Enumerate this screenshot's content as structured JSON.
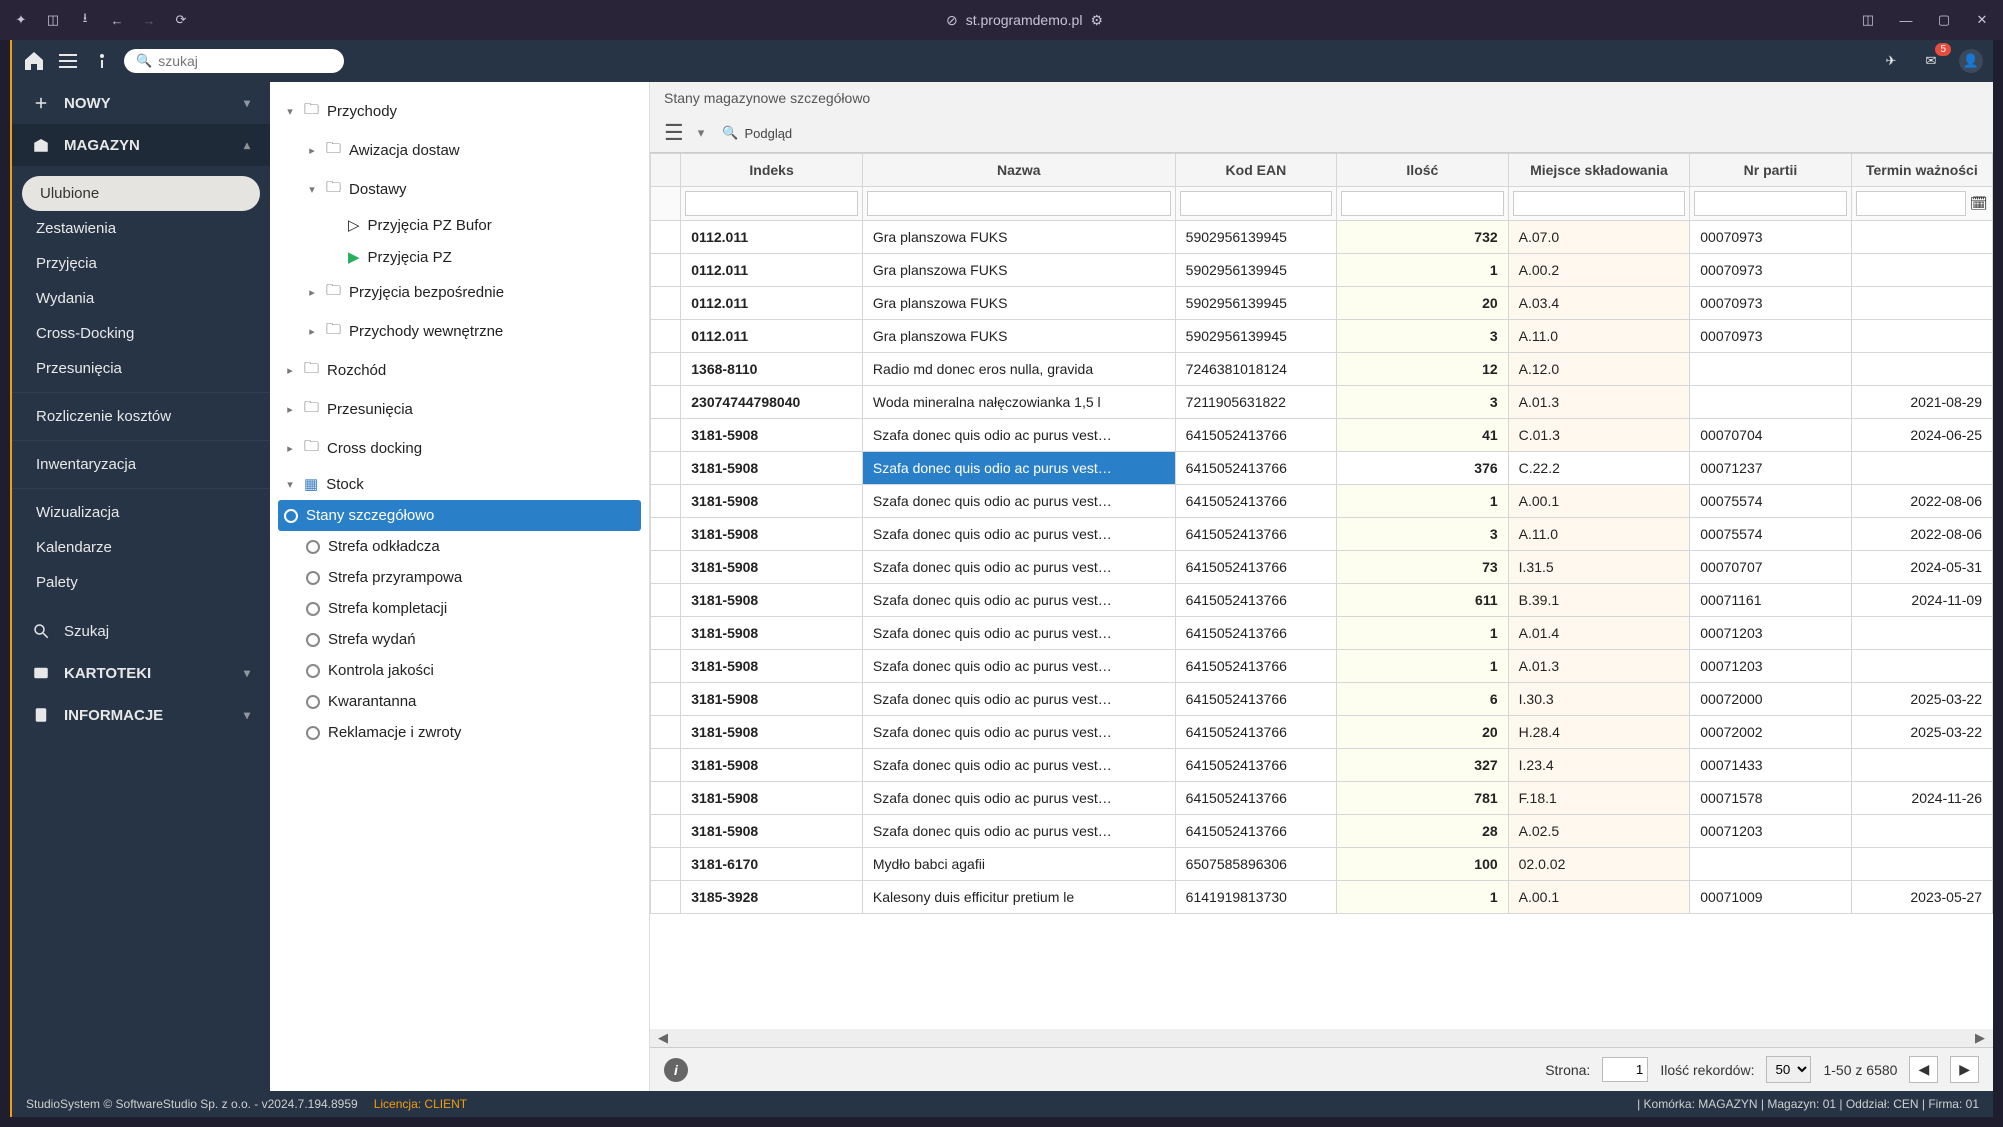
{
  "browser": {
    "url": "st.programdemo.pl"
  },
  "search_placeholder": "szukaj",
  "leftnav": {
    "new": "NOWY",
    "warehouse": "MAGAZYN",
    "items": [
      "Ulubione",
      "Zestawienia",
      "Przyjęcia",
      "Wydania",
      "Cross-Docking",
      "Przesunięcia"
    ],
    "items2": [
      "Rozliczenie kosztów"
    ],
    "items3": [
      "Inwentaryzacja"
    ],
    "items4": [
      "Wizualizacja",
      "Kalendarze",
      "Palety"
    ],
    "search": "Szukaj",
    "kartoteki": "KARTOTEKI",
    "informacje": "INFORMACJE"
  },
  "tree": {
    "przychody": "Przychody",
    "awizacja": "Awizacja dostaw",
    "dostawy": "Dostawy",
    "pz_bufor": "Przyjęcia PZ Bufor",
    "pz": "Przyjęcia PZ",
    "bezposrednie": "Przyjęcia bezpośrednie",
    "wewnetrzne": "Przychody wewnętrzne",
    "rozchod": "Rozchód",
    "przesuniecia": "Przesunięcia",
    "crossdocking": "Cross docking",
    "stock": "Stock",
    "stany": "Stany szczegółowo",
    "strefa_odk": "Strefa odkładcza",
    "strefa_przy": "Strefa przyrampowa",
    "strefa_komp": "Strefa kompletacji",
    "strefa_wyd": "Strefa wydań",
    "kontrola": "Kontrola jakości",
    "kwarantanna": "Kwarantanna",
    "reklamacje": "Reklamacje i zwroty"
  },
  "content": {
    "title": "Stany magazynowe szczegółowo",
    "preview_btn": "Podgląd",
    "columns": [
      "",
      "Indeks",
      "Nazwa",
      "Kod EAN",
      "Ilość",
      "Miejsce składowania",
      "Nr partii",
      "Termin ważności"
    ]
  },
  "rows": [
    {
      "idx": "0112.011",
      "name": "Gra planszowa FUKS",
      "ean": "5902956139945",
      "qty": "732",
      "loc": "A.07.0",
      "batch": "00070973",
      "exp": ""
    },
    {
      "idx": "0112.011",
      "name": "Gra planszowa FUKS",
      "ean": "5902956139945",
      "qty": "1",
      "loc": "A.00.2",
      "batch": "00070973",
      "exp": ""
    },
    {
      "idx": "0112.011",
      "name": "Gra planszowa FUKS",
      "ean": "5902956139945",
      "qty": "20",
      "loc": "A.03.4",
      "batch": "00070973",
      "exp": ""
    },
    {
      "idx": "0112.011",
      "name": "Gra planszowa FUKS",
      "ean": "5902956139945",
      "qty": "3",
      "loc": "A.11.0",
      "batch": "00070973",
      "exp": ""
    },
    {
      "idx": "1368-8110",
      "name": "Radio md donec eros nulla, gravida",
      "ean": "7246381018124",
      "qty": "12",
      "loc": "A.12.0",
      "batch": "",
      "exp": ""
    },
    {
      "idx": "23074744798040",
      "name": "Woda mineralna nałęczowianka 1,5 l",
      "ean": "7211905631822",
      "qty": "3",
      "loc": "A.01.3",
      "batch": "",
      "exp": "2021-08-29"
    },
    {
      "idx": "3181-5908",
      "name": "Szafa donec quis odio ac purus vest…",
      "ean": "6415052413766",
      "qty": "41",
      "loc": "C.01.3",
      "batch": "00070704",
      "exp": "2024-06-25"
    },
    {
      "idx": "3181-5908",
      "name": "Szafa donec quis odio ac purus vest…",
      "ean": "6415052413766",
      "qty": "376",
      "loc": "C.22.2",
      "batch": "00071237",
      "exp": "",
      "selected": true
    },
    {
      "idx": "3181-5908",
      "name": "Szafa donec quis odio ac purus vest…",
      "ean": "6415052413766",
      "qty": "1",
      "loc": "A.00.1",
      "batch": "00075574",
      "exp": "2022-08-06"
    },
    {
      "idx": "3181-5908",
      "name": "Szafa donec quis odio ac purus vest…",
      "ean": "6415052413766",
      "qty": "3",
      "loc": "A.11.0",
      "batch": "00075574",
      "exp": "2022-08-06"
    },
    {
      "idx": "3181-5908",
      "name": "Szafa donec quis odio ac purus vest…",
      "ean": "6415052413766",
      "qty": "73",
      "loc": "I.31.5",
      "batch": "00070707",
      "exp": "2024-05-31"
    },
    {
      "idx": "3181-5908",
      "name": "Szafa donec quis odio ac purus vest…",
      "ean": "6415052413766",
      "qty": "611",
      "loc": "B.39.1",
      "batch": "00071161",
      "exp": "2024-11-09"
    },
    {
      "idx": "3181-5908",
      "name": "Szafa donec quis odio ac purus vest…",
      "ean": "6415052413766",
      "qty": "1",
      "loc": "A.01.4",
      "batch": "00071203",
      "exp": ""
    },
    {
      "idx": "3181-5908",
      "name": "Szafa donec quis odio ac purus vest…",
      "ean": "6415052413766",
      "qty": "1",
      "loc": "A.01.3",
      "batch": "00071203",
      "exp": ""
    },
    {
      "idx": "3181-5908",
      "name": "Szafa donec quis odio ac purus vest…",
      "ean": "6415052413766",
      "qty": "6",
      "loc": "I.30.3",
      "batch": "00072000",
      "exp": "2025-03-22"
    },
    {
      "idx": "3181-5908",
      "name": "Szafa donec quis odio ac purus vest…",
      "ean": "6415052413766",
      "qty": "20",
      "loc": "H.28.4",
      "batch": "00072002",
      "exp": "2025-03-22"
    },
    {
      "idx": "3181-5908",
      "name": "Szafa donec quis odio ac purus vest…",
      "ean": "6415052413766",
      "qty": "327",
      "loc": "I.23.4",
      "batch": "00071433",
      "exp": ""
    },
    {
      "idx": "3181-5908",
      "name": "Szafa donec quis odio ac purus vest…",
      "ean": "6415052413766",
      "qty": "781",
      "loc": "F.18.1",
      "batch": "00071578",
      "exp": "2024-11-26"
    },
    {
      "idx": "3181-5908",
      "name": "Szafa donec quis odio ac purus vest…",
      "ean": "6415052413766",
      "qty": "28",
      "loc": "A.02.5",
      "batch": "00071203",
      "exp": ""
    },
    {
      "idx": "3181-6170",
      "name": "Mydło babci agafii",
      "ean": "6507585896306",
      "qty": "100",
      "loc": "02.0.02",
      "batch": "",
      "exp": ""
    },
    {
      "idx": "3185-3928",
      "name": "Kalesony duis efficitur pretium le",
      "ean": "6141919813730",
      "qty": "1",
      "loc": "A.00.1",
      "batch": "00071009",
      "exp": "2023-05-27"
    }
  ],
  "pager": {
    "page_label": "Strona:",
    "page_value": "1",
    "records_label": "Ilość rekordów:",
    "records_value": "50",
    "range": "1-50 z 6580"
  },
  "status": {
    "left": "StudioSystem © SoftwareStudio Sp. z o.o. - v2024.7.194.8959",
    "licence": "Licencja: CLIENT",
    "right": "| Komórka: MAGAZYN | Magazyn: 01 | Oddział: CEN | Firma: 01"
  },
  "notif_count": "5"
}
